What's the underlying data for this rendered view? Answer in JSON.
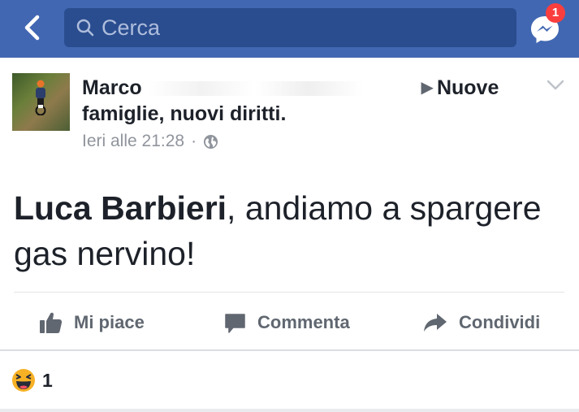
{
  "header": {
    "search_placeholder": "Cerca",
    "messenger_badge": "1",
    "bar_color": "#4267b2"
  },
  "post": {
    "author": "Marco",
    "group": "Nuove famiglie, nuovi diritti.",
    "timestamp": "Ieri alle 21:28",
    "separator": "·",
    "privacy_icon": "globe-icon",
    "mention": "Luca Barbieri",
    "text": ", andiamo a spargere gas nervino!"
  },
  "actions": {
    "like_label": "Mi piace",
    "comment_label": "Commenta",
    "share_label": "Condividi"
  },
  "reactions": {
    "type": "haha",
    "count": "1"
  }
}
